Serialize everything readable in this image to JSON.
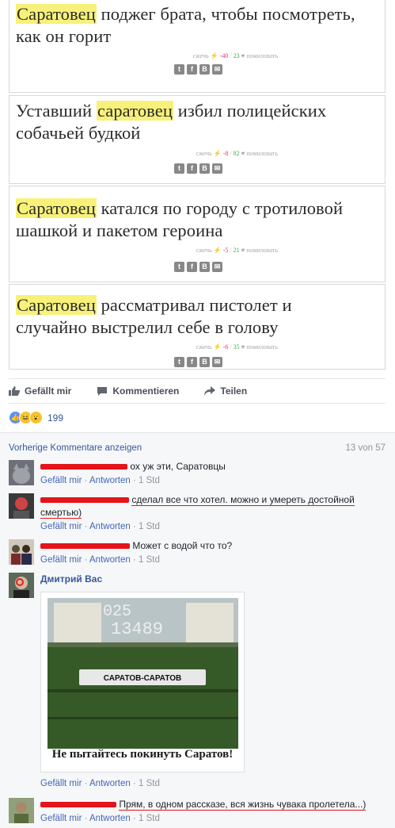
{
  "cards": [
    {
      "hl": "Саратовец",
      "rest_line1": " поджег брата, чтобы посмотреть,",
      "line2": "как он горит",
      "burn": "сжечь",
      "minus": "-40",
      "plus": "23",
      "pardon": "помиловать"
    },
    {
      "pre": "Уставший ",
      "hl": "саратовец",
      "rest_line1": " избил полицейских",
      "line2": "собачьей будкой",
      "burn": "сжечь",
      "minus": "-8",
      "plus": "82",
      "pardon": "помиловать"
    },
    {
      "hl": "Саратовец",
      "rest_line1": " катался по городу с тротиловой",
      "line2": "шашкой и пакетом героина",
      "burn": "сжечь",
      "minus": "-5",
      "plus": "21",
      "pardon": "помиловать"
    },
    {
      "hl": "Саратовец",
      "rest_line1": " рассматривал пистолет и",
      "line2": "случайно выстрелил себе в голову",
      "burn": "сжечь",
      "minus": "-6",
      "plus": "35",
      "pardon": "помиловать"
    }
  ],
  "social_icons": [
    "twitter-icon",
    "facebook-icon",
    "vk-icon",
    "mail-icon"
  ],
  "actions": {
    "like": "Gefällt mir",
    "comment": "Kommentieren",
    "share": "Teilen"
  },
  "reactions": {
    "count": "199",
    "types": [
      "like",
      "haha",
      "wow"
    ]
  },
  "comments_header": {
    "previous": "Vorherige Kommentare anzeigen",
    "counter": "13 von 57"
  },
  "comments": [
    {
      "text": "ох уж эти, Саратовцы",
      "like": "Gefällt mir",
      "reply": "Antworten",
      "time": "1 Std"
    },
    {
      "text": "сделал все что хотел. можно и умереть достойной смертью)",
      "like": "Gefällt mir",
      "reply": "Antworten",
      "time": "1 Std"
    },
    {
      "text": "Может с водой что то?",
      "like": "Gefällt mir",
      "reply": "Antworten",
      "time": "1 Std"
    },
    {
      "name": "Дмитрий Вас",
      "like": "Gefällt mir",
      "reply": "Antworten",
      "time": "1 Std",
      "image": {
        "number_top": "025",
        "number": "13489",
        "plate": "САРАТОВ-САРАТОВ",
        "caption": "Не пытайтесь покинуть Саратов!"
      }
    },
    {
      "text": "Прям, в одном рассказе, вся жизнь чувака пролетела...)",
      "like": "Gefällt mir",
      "reply": "Antworten",
      "time": "1 Std"
    }
  ],
  "colors": {
    "highlight": "#f7f17a",
    "link": "#365899",
    "redaction": "#e4141a",
    "train_green": "#3a5a2a"
  }
}
